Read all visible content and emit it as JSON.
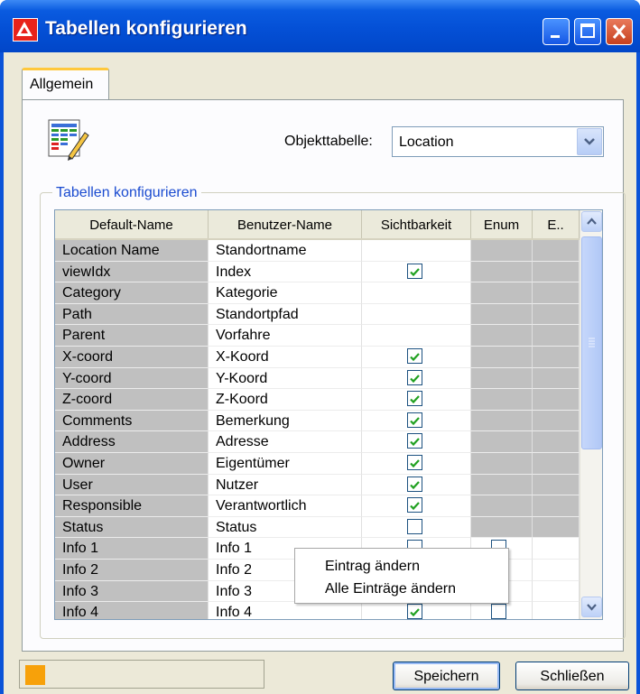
{
  "window": {
    "title": "Tabellen konfigurieren"
  },
  "titlebar_buttons": [
    "minimize-icon",
    "maximize-icon",
    "close-icon"
  ],
  "tabs": [
    {
      "label": "Allgemein",
      "active": true
    }
  ],
  "objekttabelle": {
    "label": "Objekttabelle:",
    "value": "Location"
  },
  "group": {
    "title": "Tabellen konfigurieren"
  },
  "table": {
    "columns": [
      "Default-Name",
      "Benutzer-Name",
      "Sichtbarkeit",
      "Enum",
      "E.."
    ],
    "rows": [
      {
        "default": "Location Name",
        "user": "Standortname",
        "visible": null,
        "enum": null
      },
      {
        "default": "viewIdx",
        "user": "Index",
        "visible": true,
        "enum": null
      },
      {
        "default": "Category",
        "user": "Kategorie",
        "visible": null,
        "enum": null
      },
      {
        "default": "Path",
        "user": "Standortpfad",
        "visible": null,
        "enum": null
      },
      {
        "default": "Parent",
        "user": "Vorfahre",
        "visible": null,
        "enum": null
      },
      {
        "default": "X-coord",
        "user": "X-Koord",
        "visible": true,
        "enum": null
      },
      {
        "default": "Y-coord",
        "user": "Y-Koord",
        "visible": true,
        "enum": null
      },
      {
        "default": "Z-coord",
        "user": "Z-Koord",
        "visible": true,
        "enum": null
      },
      {
        "default": "Comments",
        "user": "Bemerkung",
        "visible": true,
        "enum": null
      },
      {
        "default": "Address",
        "user": "Adresse",
        "visible": true,
        "enum": null
      },
      {
        "default": "Owner",
        "user": "Eigentümer",
        "visible": true,
        "enum": null
      },
      {
        "default": "User",
        "user": "Nutzer",
        "visible": true,
        "enum": null
      },
      {
        "default": "Responsible",
        "user": "Verantwortlich",
        "visible": true,
        "enum": null
      },
      {
        "default": "Status",
        "user": "Status",
        "visible": false,
        "enum": null
      },
      {
        "default": "Info 1",
        "user": "Info 1",
        "visible": false,
        "enum": false
      },
      {
        "default": "Info 2",
        "user": "Info 2",
        "visible": false,
        "enum": false
      },
      {
        "default": "Info 3",
        "user": "Info 3",
        "visible": false,
        "enum": false
      },
      {
        "default": "Info 4",
        "user": "Info 4",
        "visible": true,
        "enum": false
      }
    ]
  },
  "context_menu": {
    "items": [
      "Eintrag ändern",
      "Alle Einträge ändern"
    ]
  },
  "buttons": {
    "save": "Speichern",
    "close": "Schließen"
  },
  "colors": {
    "status_indicator": "#f7a10a",
    "titlebar": "#0450d6",
    "check": "#21a121"
  }
}
